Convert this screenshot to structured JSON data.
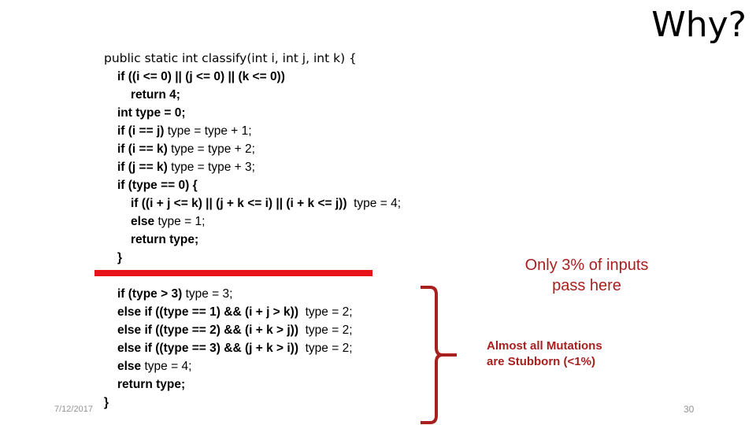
{
  "slide": {
    "title": "Why?",
    "colors": {
      "separator_red": "#e8131a",
      "annotation_red": "#a81f1f",
      "brace_red": "#a81f1f",
      "code_black": "#000000",
      "footer_gray": "#939393"
    }
  },
  "code_block_top": {
    "lines": [
      {
        "indent": 0,
        "bold": "public static int classify(int i, int j, int k) {",
        "regular": "",
        "first": true
      },
      {
        "indent": 1,
        "bold": "if ((i <= 0) || (j <= 0) || (k <= 0))",
        "regular": ""
      },
      {
        "indent": 2,
        "bold": "return 4;",
        "regular": ""
      },
      {
        "indent": 1,
        "bold": "int type = 0;",
        "regular": ""
      },
      {
        "indent": 1,
        "bold": "if (i == j) ",
        "regular": "type = type + 1;"
      },
      {
        "indent": 1,
        "bold": "if (i == k) ",
        "regular": "type = type + 2;"
      },
      {
        "indent": 1,
        "bold": "if (j == k) ",
        "regular": "type = type + 3;"
      },
      {
        "indent": 1,
        "bold": "if (type == 0) {",
        "regular": ""
      },
      {
        "indent": 2,
        "bold": "if ((i + j <= k) || (j + k <= i) || (i + k <= j))  ",
        "regular": "type = 4;"
      },
      {
        "indent": 2,
        "bold": "else ",
        "regular": "type = 1;"
      },
      {
        "indent": 2,
        "bold": "return type;",
        "regular": ""
      },
      {
        "indent": 1,
        "bold": "}",
        "regular": ""
      }
    ]
  },
  "code_block_bottom": {
    "lines": [
      {
        "indent": 1,
        "bold": "if (type > 3) ",
        "regular": "type = 3;"
      },
      {
        "indent": 1,
        "bold": "else if ((type == 1) && (i + j > k))  ",
        "regular": "type = 2;"
      },
      {
        "indent": 1,
        "bold": "else if ((type == 2) && (i + k > j))  ",
        "regular": "type = 2;"
      },
      {
        "indent": 1,
        "bold": "else if ((type == 3) && (j + k > i))  ",
        "regular": "type = 2;"
      },
      {
        "indent": 1,
        "bold": "else ",
        "regular": "type = 4;"
      },
      {
        "indent": 1,
        "bold": "return type;",
        "regular": ""
      },
      {
        "indent": 0,
        "bold": "}",
        "regular": ""
      }
    ]
  },
  "annotations": {
    "pass_rate": "Only 3% of inputs\npass here",
    "mutations": "Almost all Mutations\nare Stubborn (<1%)"
  },
  "footer": {
    "date": "7/12/2017",
    "page_number": "30"
  }
}
